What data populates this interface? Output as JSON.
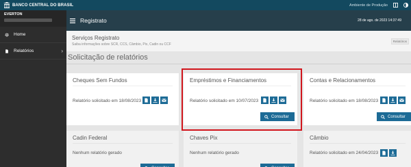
{
  "topbar": {
    "brand": "BANCO CENTRAL DO BRASIL",
    "environment": "Ambiente de Produção"
  },
  "sidebar": {
    "user": "EVERTON",
    "items": [
      {
        "label": "Home",
        "icon": "gear-icon"
      },
      {
        "label": "Relatórios",
        "icon": "document-icon"
      }
    ]
  },
  "header": {
    "title": "Registrato",
    "datetime": "28 de ago. de 2023 14:37:49"
  },
  "services": {
    "title": "Serviços Registrato",
    "subtitle": "Saiba informações sobre SCR, CCS, Câmbio, Pix, Cadin ou CCF",
    "badge": "Relatórios"
  },
  "section_title": "Solicitação de relatórios",
  "consult_label": "Consultar",
  "cards": [
    {
      "title": "Cheques Sem Fundos",
      "status": "Relatório solicitado em 18/08/2023"
    },
    {
      "title": "Empréstimos e Financiamentos",
      "status": "Relatório solicitado em 10/07/2023"
    },
    {
      "title": "Contas e Relacionamentos",
      "status": "Relatório solicitado em 18/08/2023"
    },
    {
      "title": "Cadin Federal",
      "status": "Nenhum relatório gerado"
    },
    {
      "title": "Chaves Pix",
      "status": "Nenhum relatório gerado"
    },
    {
      "title": "Câmbio",
      "status": "Relatório solicitado em 24/04/2023"
    }
  ],
  "colors": {
    "topbar": "#13495f",
    "header": "#263f4b",
    "sidebar": "#2d2d2d",
    "primary": "#1d6b96",
    "highlight": "#d1151c"
  }
}
